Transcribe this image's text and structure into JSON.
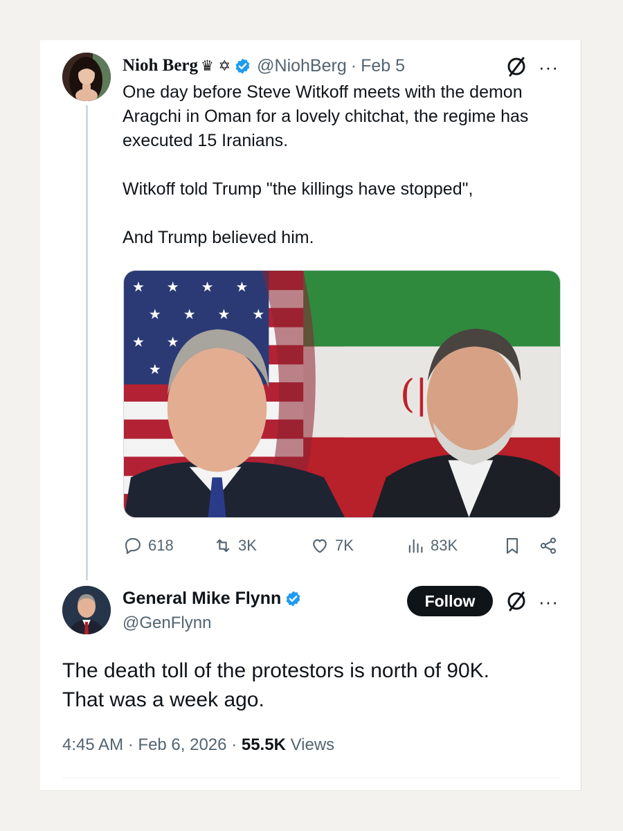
{
  "original_tweet": {
    "author_name": "Nioh Berg",
    "name_emojis": "♛ ✡",
    "handle": "@NiohBerg",
    "separator": "·",
    "date": "Feb 5",
    "more_label": "···",
    "text_lines": [
      "One day before Steve Witkoff meets with the demon Aragchi in Oman for a lovely chitchat, the regime has executed 15 Iranians.",
      "Witkoff told Trump \"the killings have stopped\",",
      "And Trump believed him."
    ],
    "stats": {
      "replies": "618",
      "reposts": "3K",
      "likes": "7K",
      "views": "83K"
    }
  },
  "reply_tweet": {
    "author_name": "General Mike Flynn",
    "handle": "@GenFlynn",
    "follow_label": "Follow",
    "more_label": "···",
    "text_lines": [
      "The death toll of the protestors is north of 90K.",
      "That was a week ago."
    ],
    "time": "4:45 AM",
    "separator": "·",
    "date": "Feb 6, 2026",
    "views_count": "55.5K",
    "views_label": "Views"
  },
  "colors": {
    "verified": "#1d9bf0",
    "text_primary": "#0f1419",
    "text_secondary": "#536471",
    "follow_bg": "#0f1419",
    "page_bg": "#f3f2ef"
  }
}
